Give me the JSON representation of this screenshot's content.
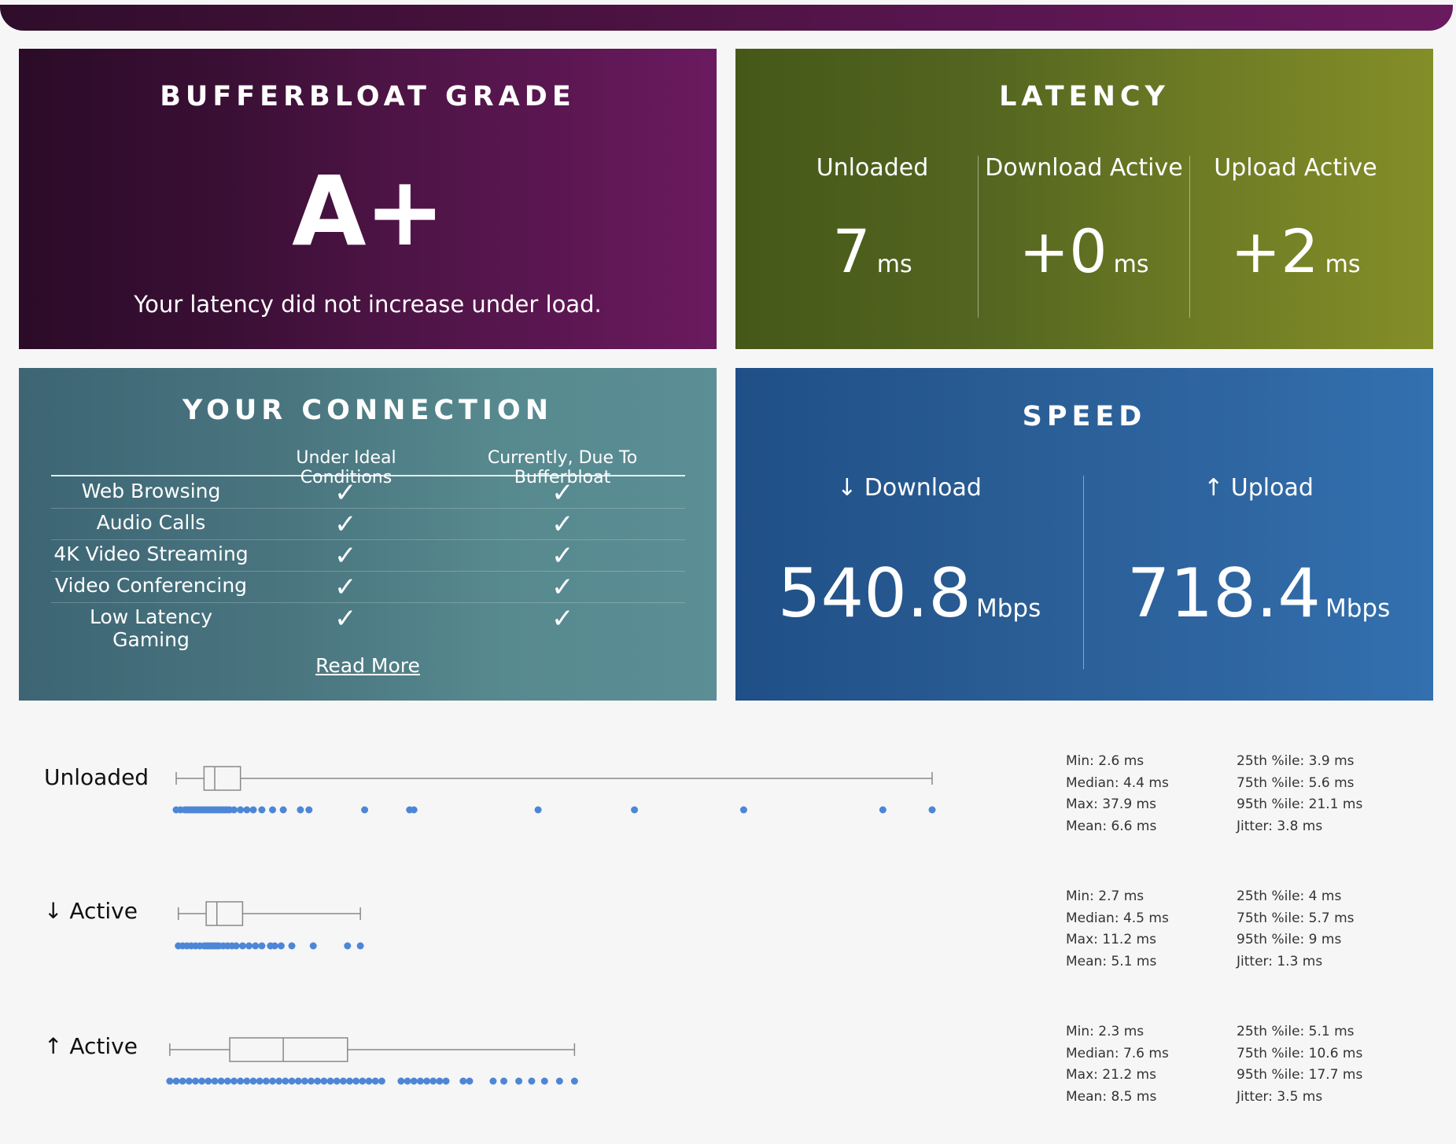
{
  "grade": {
    "title": "BUFFERBLOAT GRADE",
    "value": "A+",
    "description": "Your latency did not increase under load."
  },
  "latency": {
    "title": "LATENCY",
    "columns": [
      {
        "label": "Unloaded",
        "value": "7",
        "unit": "ms"
      },
      {
        "label": "Download Active",
        "value": "+0",
        "unit": "ms"
      },
      {
        "label": "Upload Active",
        "value": "+2",
        "unit": "ms"
      }
    ]
  },
  "connection": {
    "title": "YOUR CONNECTION",
    "headers": [
      "Under Ideal Conditions",
      "Currently, Due To Bufferbloat"
    ],
    "rows": [
      {
        "label": "Web Browsing",
        "ideal": "✓",
        "current": "✓"
      },
      {
        "label": "Audio Calls",
        "ideal": "✓",
        "current": "✓"
      },
      {
        "label": "4K Video Streaming",
        "ideal": "✓",
        "current": "✓"
      },
      {
        "label": "Video Conferencing",
        "ideal": "✓",
        "current": "✓"
      },
      {
        "label": "Low Latency Gaming",
        "ideal": "✓",
        "current": "✓"
      }
    ],
    "read_more": "Read More"
  },
  "speed": {
    "title": "SPEED",
    "download": {
      "label": "↓ Download",
      "value": "540.8",
      "unit": "Mbps"
    },
    "upload": {
      "label": "↑ Upload",
      "value": "718.4",
      "unit": "Mbps"
    }
  },
  "details": [
    {
      "label": "Unloaded",
      "stats_left": [
        "Min: 2.6 ms",
        "Median: 4.4 ms",
        "Max: 37.9 ms",
        "Mean: 6.6 ms"
      ],
      "stats_right": [
        "25th %ile: 3.9 ms",
        "75th %ile: 5.6 ms",
        "95th %ile: 21.1 ms",
        "Jitter: 3.8 ms"
      ],
      "box": {
        "min": 2.6,
        "q1": 3.9,
        "median": 4.4,
        "q3": 5.6,
        "max": 37.9
      }
    },
    {
      "label": "↓ Active",
      "stats_left": [
        "Min: 2.7 ms",
        "Median: 4.5 ms",
        "Max: 11.2 ms",
        "Mean: 5.1 ms"
      ],
      "stats_right": [
        "25th %ile: 4 ms",
        "75th %ile: 5.7 ms",
        "95th %ile: 9 ms",
        "Jitter: 1.3 ms"
      ],
      "box": {
        "min": 2.7,
        "q1": 4.0,
        "median": 4.5,
        "q3": 5.7,
        "max": 11.2
      }
    },
    {
      "label": "↑ Active",
      "stats_left": [
        "Min: 2.3 ms",
        "Median: 7.6 ms",
        "Max: 21.2 ms",
        "Mean: 8.5 ms"
      ],
      "stats_right": [
        "25th %ile: 5.1 ms",
        "75th %ile: 10.6 ms",
        "95th %ile: 17.7 ms",
        "Jitter: 3.5 ms"
      ],
      "box": {
        "min": 2.3,
        "q1": 5.1,
        "median": 7.6,
        "q3": 10.6,
        "max": 21.2
      }
    }
  ],
  "chart_data": {
    "type": "boxplot",
    "unit": "ms",
    "series": [
      {
        "name": "Unloaded",
        "min": 2.6,
        "q1": 3.9,
        "median": 4.4,
        "q3": 5.6,
        "max": 37.9,
        "points": [
          2.6,
          2.8,
          3.0,
          3.1,
          3.2,
          3.3,
          3.4,
          3.5,
          3.6,
          3.7,
          3.8,
          3.9,
          4.0,
          4.1,
          4.2,
          4.3,
          4.4,
          4.5,
          4.6,
          4.7,
          4.8,
          4.9,
          5.0,
          5.1,
          5.3,
          5.6,
          5.9,
          6.2,
          6.6,
          7.1,
          7.6,
          8.4,
          8.8,
          11.4,
          13.5,
          13.7,
          19.5,
          24.0,
          29.1,
          35.6,
          37.9
        ]
      },
      {
        "name": "↓ Active",
        "min": 2.7,
        "q1": 4.0,
        "median": 4.5,
        "q3": 5.7,
        "max": 11.2,
        "points": [
          2.7,
          2.9,
          3.1,
          3.3,
          3.5,
          3.7,
          3.9,
          4.0,
          4.1,
          4.2,
          4.3,
          4.4,
          4.5,
          4.6,
          4.8,
          5.0,
          5.2,
          5.4,
          5.7,
          6.0,
          6.3,
          6.6,
          7.0,
          7.2,
          7.5,
          8.0,
          9.0,
          10.6,
          11.2
        ]
      },
      {
        "name": "↑ Active",
        "min": 2.3,
        "q1": 5.1,
        "median": 7.6,
        "q3": 10.6,
        "max": 21.2,
        "points": [
          2.3,
          2.6,
          2.9,
          3.2,
          3.5,
          3.8,
          4.1,
          4.4,
          4.7,
          5.0,
          5.3,
          5.6,
          5.9,
          6.2,
          6.5,
          6.8,
          7.1,
          7.4,
          7.7,
          8.0,
          8.3,
          8.6,
          8.9,
          9.2,
          9.5,
          9.8,
          10.1,
          10.4,
          10.7,
          11.0,
          11.3,
          11.6,
          11.9,
          12.2,
          13.1,
          13.4,
          13.7,
          14.0,
          14.3,
          14.6,
          14.9,
          15.2,
          16.0,
          16.3,
          17.4,
          17.9,
          18.6,
          19.2,
          19.8,
          20.5,
          21.2
        ]
      }
    ]
  },
  "colors": {
    "grade_bg": "#4a1240",
    "latency_bg": "#5f6f22",
    "connection_bg": "#4f7c85",
    "speed_bg": "#2a5e97",
    "dot": "#4d86d6",
    "box": "#888888"
  }
}
